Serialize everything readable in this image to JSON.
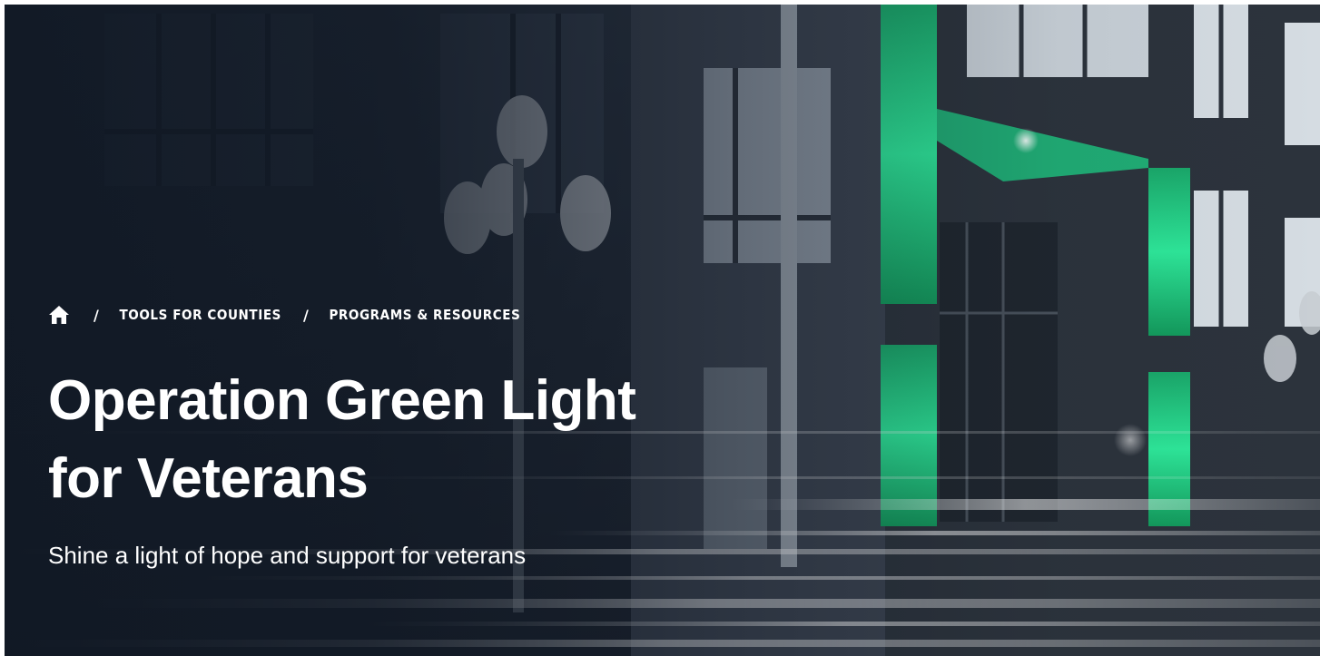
{
  "breadcrumb": {
    "home_icon": "home-icon",
    "separator": "/",
    "items": [
      {
        "label": "TOOLS FOR COUNTIES"
      },
      {
        "label": "PROGRAMS & RESOURCES"
      }
    ]
  },
  "hero": {
    "title_line1": "Operation Green Light",
    "title_line2": "for Veterans",
    "subtitle": "Shine a light of hope and support for veterans",
    "accent_color": "#2ee89a",
    "text_color": "#ffffff",
    "background_color": "#1b2330"
  }
}
